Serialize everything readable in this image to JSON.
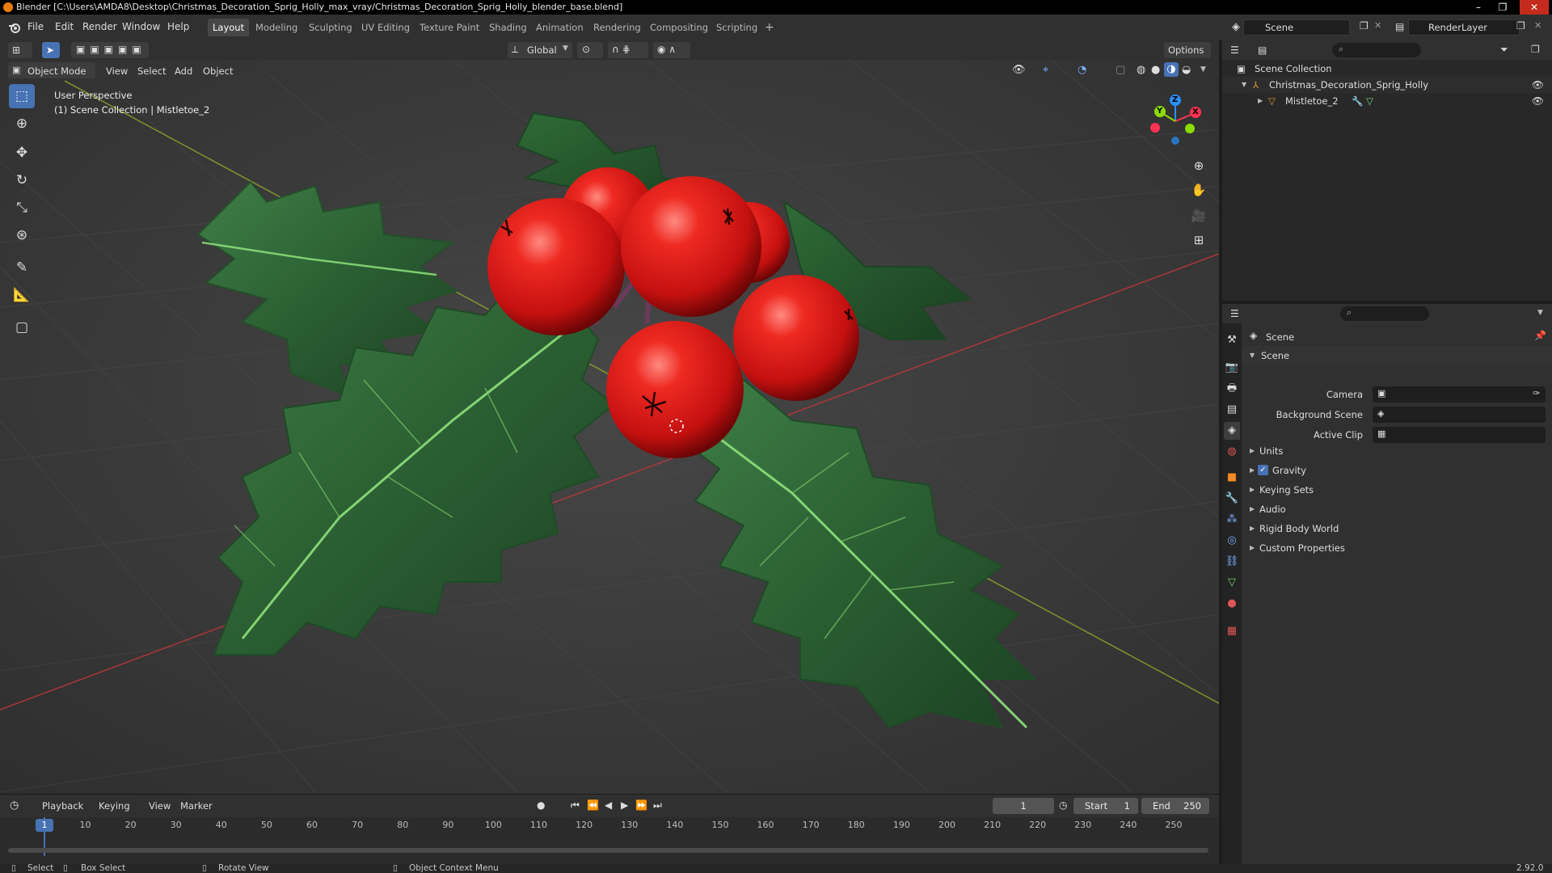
{
  "window": {
    "title": "Blender [C:\\Users\\AMDA8\\Desktop\\Christmas_Decoration_Sprig_Holly_max_vray/Christmas_Decoration_Sprig_Holly_blender_base.blend]",
    "minimize": "–",
    "maximize": "❐",
    "close": "✕"
  },
  "menus": [
    "File",
    "Edit",
    "Render",
    "Window",
    "Help"
  ],
  "workspaces": [
    "Layout",
    "Modeling",
    "Sculpting",
    "UV Editing",
    "Texture Paint",
    "Shading",
    "Animation",
    "Rendering",
    "Compositing",
    "Scripting"
  ],
  "add_workspace": "+",
  "scene_selector": "Scene",
  "render_layer": "RenderLayer",
  "viewport_header": {
    "transform_orientation": "Global",
    "options": "Options",
    "mode": "Object Mode",
    "menus": [
      "View",
      "Select",
      "Add",
      "Object"
    ]
  },
  "viewport": {
    "perspective": "User Perspective",
    "context": "(1) Scene Collection | Mistletoe_2",
    "gizmo": {
      "x": "X",
      "y": "Y",
      "z": "Z"
    }
  },
  "outliner": {
    "root": "Scene Collection",
    "collection": "Christmas_Decoration_Sprig_Holly",
    "object": "Mistletoe_2"
  },
  "properties": {
    "context": "Scene",
    "panel": "Scene",
    "fields": [
      {
        "label": "Camera"
      },
      {
        "label": "Background Scene"
      },
      {
        "label": "Active Clip"
      }
    ],
    "subpanels": [
      "Units",
      "Gravity",
      "Keying Sets",
      "Audio",
      "Rigid Body World",
      "Custom Properties"
    ],
    "gravity_checked": true
  },
  "timeline": {
    "menus": [
      "Playback",
      "Keying",
      "View",
      "Marker"
    ],
    "current_frame": "1",
    "start_label": "Start",
    "start": "1",
    "end_label": "End",
    "end": "250",
    "ticks": [
      "1",
      "10",
      "20",
      "30",
      "40",
      "50",
      "60",
      "70",
      "80",
      "90",
      "100",
      "110",
      "120",
      "130",
      "140",
      "150",
      "160",
      "170",
      "180",
      "190",
      "200",
      "210",
      "220",
      "230",
      "240",
      "250"
    ]
  },
  "statusbar": {
    "select": "Select",
    "box_select": "Box Select",
    "rotate_view": "Rotate View",
    "context_menu": "Object Context Menu",
    "version": "2.92.0"
  },
  "colors": {
    "accent": "#4772b3",
    "x_axis": "#ff3352",
    "y_axis": "#8bdc00",
    "z_axis": "#2890ff",
    "berry": "#d81818",
    "leaf": "#2f6b35"
  }
}
